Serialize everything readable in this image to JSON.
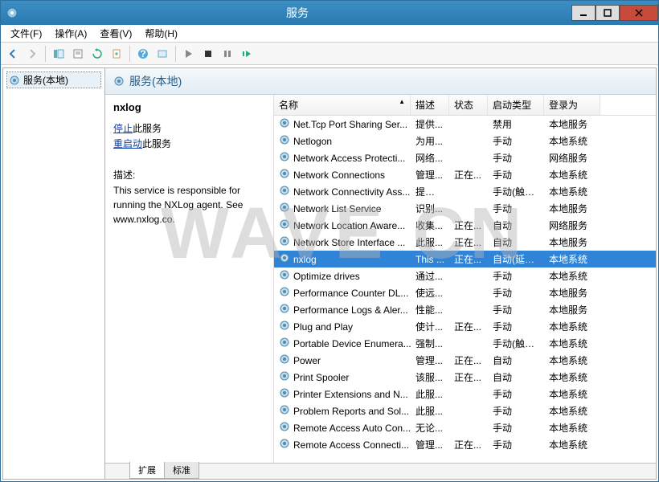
{
  "window": {
    "title": "服务"
  },
  "menubar": {
    "file": "文件(F)",
    "action": "操作(A)",
    "view": "查看(V)",
    "help": "帮助(H)"
  },
  "tree": {
    "root": "服务(本地)"
  },
  "main_header": "服务(本地)",
  "detail": {
    "selected_name": "nxlog",
    "stop_link": "停止",
    "stop_suffix": "此服务",
    "restart_link": "重启动",
    "restart_suffix": "此服务",
    "desc_label": "描述:",
    "desc_text": "This service is responsible for running the NXLog agent. See www.nxlog.co."
  },
  "columns": {
    "name": "名称",
    "desc": "描述",
    "status": "状态",
    "start": "启动类型",
    "logon": "登录为"
  },
  "services": [
    {
      "name": "Net.Tcp Port Sharing Ser...",
      "desc": "提供...",
      "status": "",
      "start": "禁用",
      "logon": "本地服务"
    },
    {
      "name": "Netlogon",
      "desc": "为用...",
      "status": "",
      "start": "手动",
      "logon": "本地系统"
    },
    {
      "name": "Network Access Protecti...",
      "desc": "网络...",
      "status": "",
      "start": "手动",
      "logon": "网络服务"
    },
    {
      "name": "Network Connections",
      "desc": "管理...",
      "status": "正在...",
      "start": "手动",
      "logon": "本地系统"
    },
    {
      "name": "Network Connectivity Ass...",
      "desc": "提供 ...",
      "status": "",
      "start": "手动(触发...",
      "logon": "本地系统"
    },
    {
      "name": "Network List Service",
      "desc": "识别...",
      "status": "",
      "start": "手动",
      "logon": "本地服务"
    },
    {
      "name": "Network Location Aware...",
      "desc": "收集...",
      "status": "正在...",
      "start": "自动",
      "logon": "网络服务"
    },
    {
      "name": "Network Store Interface ...",
      "desc": "此服...",
      "status": "正在...",
      "start": "自动",
      "logon": "本地服务"
    },
    {
      "name": "nxlog",
      "desc": "This ...",
      "status": "正在...",
      "start": "自动(延迟...",
      "logon": "本地系统",
      "selected": true
    },
    {
      "name": "Optimize drives",
      "desc": "通过...",
      "status": "",
      "start": "手动",
      "logon": "本地系统"
    },
    {
      "name": "Performance Counter DL...",
      "desc": "使远...",
      "status": "",
      "start": "手动",
      "logon": "本地服务"
    },
    {
      "name": "Performance Logs & Aler...",
      "desc": "性能...",
      "status": "",
      "start": "手动",
      "logon": "本地服务"
    },
    {
      "name": "Plug and Play",
      "desc": "使计...",
      "status": "正在...",
      "start": "手动",
      "logon": "本地系统"
    },
    {
      "name": "Portable Device Enumera...",
      "desc": "强制...",
      "status": "",
      "start": "手动(触发...",
      "logon": "本地系统"
    },
    {
      "name": "Power",
      "desc": "管理...",
      "status": "正在...",
      "start": "自动",
      "logon": "本地系统"
    },
    {
      "name": "Print Spooler",
      "desc": "该服...",
      "status": "正在...",
      "start": "自动",
      "logon": "本地系统"
    },
    {
      "name": "Printer Extensions and N...",
      "desc": "此服...",
      "status": "",
      "start": "手动",
      "logon": "本地系统"
    },
    {
      "name": "Problem Reports and Sol...",
      "desc": "此服...",
      "status": "",
      "start": "手动",
      "logon": "本地系统"
    },
    {
      "name": "Remote Access Auto Con...",
      "desc": "无论...",
      "status": "",
      "start": "手动",
      "logon": "本地系统"
    },
    {
      "name": "Remote Access Connecti...",
      "desc": "管理...",
      "status": "正在...",
      "start": "手动",
      "logon": "本地系统"
    }
  ],
  "tabs": {
    "extended": "扩展",
    "standard": "标准"
  },
  "watermark": "WAVE CN"
}
